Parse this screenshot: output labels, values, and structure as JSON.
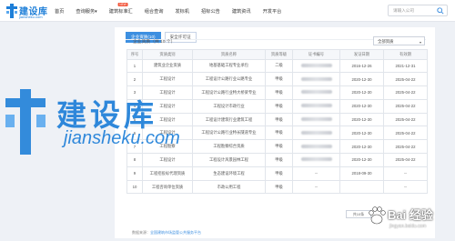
{
  "brand": {
    "name": "建设库",
    "url": "jiansheku.com",
    "accent": "#1e7fd8"
  },
  "nav": {
    "items": [
      {
        "label": "首页"
      },
      {
        "label": "查询服务",
        "caret": "▾"
      },
      {
        "label": "建筑标准汇",
        "badge": "NEW"
      },
      {
        "label": "组合查询"
      },
      {
        "label": "发标机"
      },
      {
        "label": "招标公告"
      },
      {
        "label": "建筑资讯"
      },
      {
        "label": "开发平台"
      }
    ]
  },
  "search": {
    "placeholder": "请输入公司"
  },
  "tabs": [
    {
      "label": "企业资质",
      "count": "(10)",
      "active": true
    },
    {
      "label": "安全许可证",
      "active": false
    }
  ],
  "qualification": {
    "title": "企业资质（共 10 个）",
    "filter_value": "全部资质",
    "filter_caret": "▾"
  },
  "table": {
    "columns": [
      "序号",
      "资质类别",
      "资质名称",
      "资质等级",
      "证书编号",
      "发证日期",
      "有效期"
    ],
    "rows": [
      {
        "no": "1",
        "category": "建筑业企业资质",
        "name": "地基基础工程专业承包",
        "level": "二级",
        "cert": "",
        "issued": "2016-12-26",
        "valid": "2021-12-31"
      },
      {
        "no": "2",
        "category": "工程设计",
        "name": "工程设计公路行业公路专业",
        "level": "甲级",
        "cert": "",
        "issued": "2020-12-30",
        "valid": "2025-04-22"
      },
      {
        "no": "3",
        "category": "工程设计",
        "name": "工程设计公路行业特大桥梁专业",
        "level": "甲级",
        "cert": "",
        "issued": "2020-12-30",
        "valid": "2025-04-22"
      },
      {
        "no": "4",
        "category": "工程设计",
        "name": "工程设计市政行业",
        "level": "甲级",
        "cert": "",
        "issued": "2020-12-30",
        "valid": "2025-04-22"
      },
      {
        "no": "5",
        "category": "工程设计",
        "name": "工程设计建筑行业建筑工程",
        "level": "甲级",
        "cert": "",
        "issued": "2020-12-30",
        "valid": "2025-04-22"
      },
      {
        "no": "6",
        "category": "工程设计",
        "name": "工程设计公路行业特长隧道专业",
        "level": "甲级",
        "cert": "",
        "issued": "2020-12-30",
        "valid": "2025-04-22"
      },
      {
        "no": "7",
        "category": "工程勘察",
        "name": "工程勘察综合资质",
        "level": "甲级",
        "cert": "",
        "issued": "2020-12-30",
        "valid": "2025-04-22"
      },
      {
        "no": "8",
        "category": "工程设计",
        "name": "工程设计风景园林工程",
        "level": "甲级",
        "cert": "",
        "issued": "2020-12-30",
        "valid": "2025-04-22"
      },
      {
        "no": "9",
        "category": "工程招投标代理资质",
        "name": "生态建设环境工程",
        "level": "甲级",
        "cert": "--",
        "issued": "2018-09-30",
        "valid": "--"
      },
      {
        "no": "10",
        "category": "工程咨询单位资质",
        "name": "市政公用工程",
        "level": "甲级",
        "cert": "--",
        "issued": "",
        "valid": "--"
      }
    ]
  },
  "pager": {
    "label": "共10条"
  },
  "source": {
    "prefix": "数据来源：",
    "link": "全国建筑市场监管公共服务平台"
  },
  "watermark": {
    "title": "建设库",
    "url": "jiansheku.com"
  },
  "baidu": {
    "title": "Bai 经验",
    "sub": "jingyan.baidu.com"
  }
}
